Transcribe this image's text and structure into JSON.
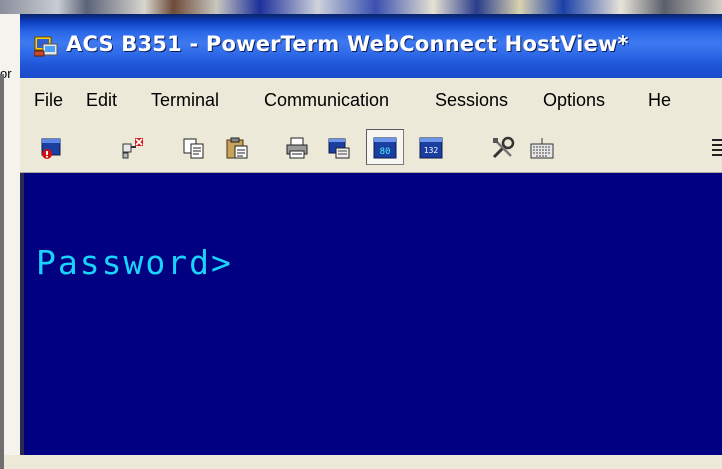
{
  "window": {
    "title": "ACS B351 - PowerTerm WebConnect HostView*"
  },
  "menu": [
    "File",
    "Edit",
    "Terminal",
    "Communication",
    "Sessions",
    "Options",
    "He"
  ],
  "toolbar": {
    "mode80_label": "80",
    "mode132_label": "132"
  },
  "terminal": {
    "prompt": "Password>",
    "background": "#000080",
    "text_color": "#19d3ff"
  },
  "desktop": {
    "left_fragment": "or"
  },
  "colors": {
    "titlebar": "#2a67e8",
    "menubar": "#ece9d8"
  }
}
